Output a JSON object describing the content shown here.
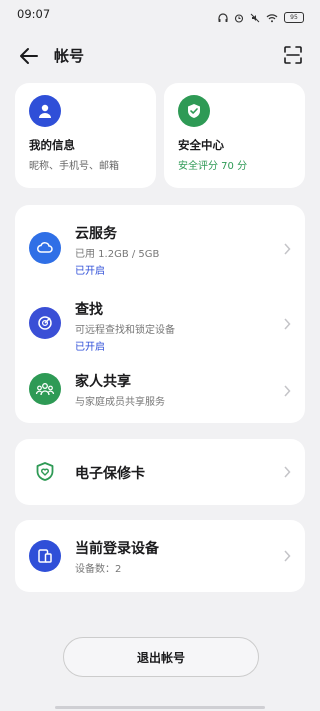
{
  "status_bar": {
    "time": "09:07",
    "battery": "95"
  },
  "header": {
    "title": "帐号"
  },
  "info_cards": [
    {
      "title": "我的信息",
      "subtitle": "昵称、手机号、邮箱",
      "color": "#2f4fd8",
      "icon": "person-icon"
    },
    {
      "title": "安全中心",
      "subtitle": "安全评分 70 分",
      "color": "#2e9a55",
      "icon": "shield-check-icon"
    }
  ],
  "services": [
    {
      "title": "云服务",
      "subtitle": "已用 1.2GB / 5GB",
      "status": "已开启",
      "color": "#2f6fe6",
      "icon": "cloud-icon"
    },
    {
      "title": "查找",
      "subtitle": "可远程查找和锁定设备",
      "status": "已开启",
      "color": "#3a4fd6",
      "icon": "radar-icon"
    },
    {
      "title": "家人共享",
      "subtitle": "与家庭成员共享服务",
      "color": "#2e9a55",
      "icon": "family-icon"
    }
  ],
  "warranty": {
    "title": "电子保修卡",
    "icon": "shield-heart-icon",
    "color": "#2e9a55"
  },
  "devices": {
    "title": "当前登录设备",
    "subtitle": "设备数：2",
    "color": "#2f4fd8",
    "icon": "device-icon"
  },
  "logout": {
    "label": "退出帐号"
  }
}
